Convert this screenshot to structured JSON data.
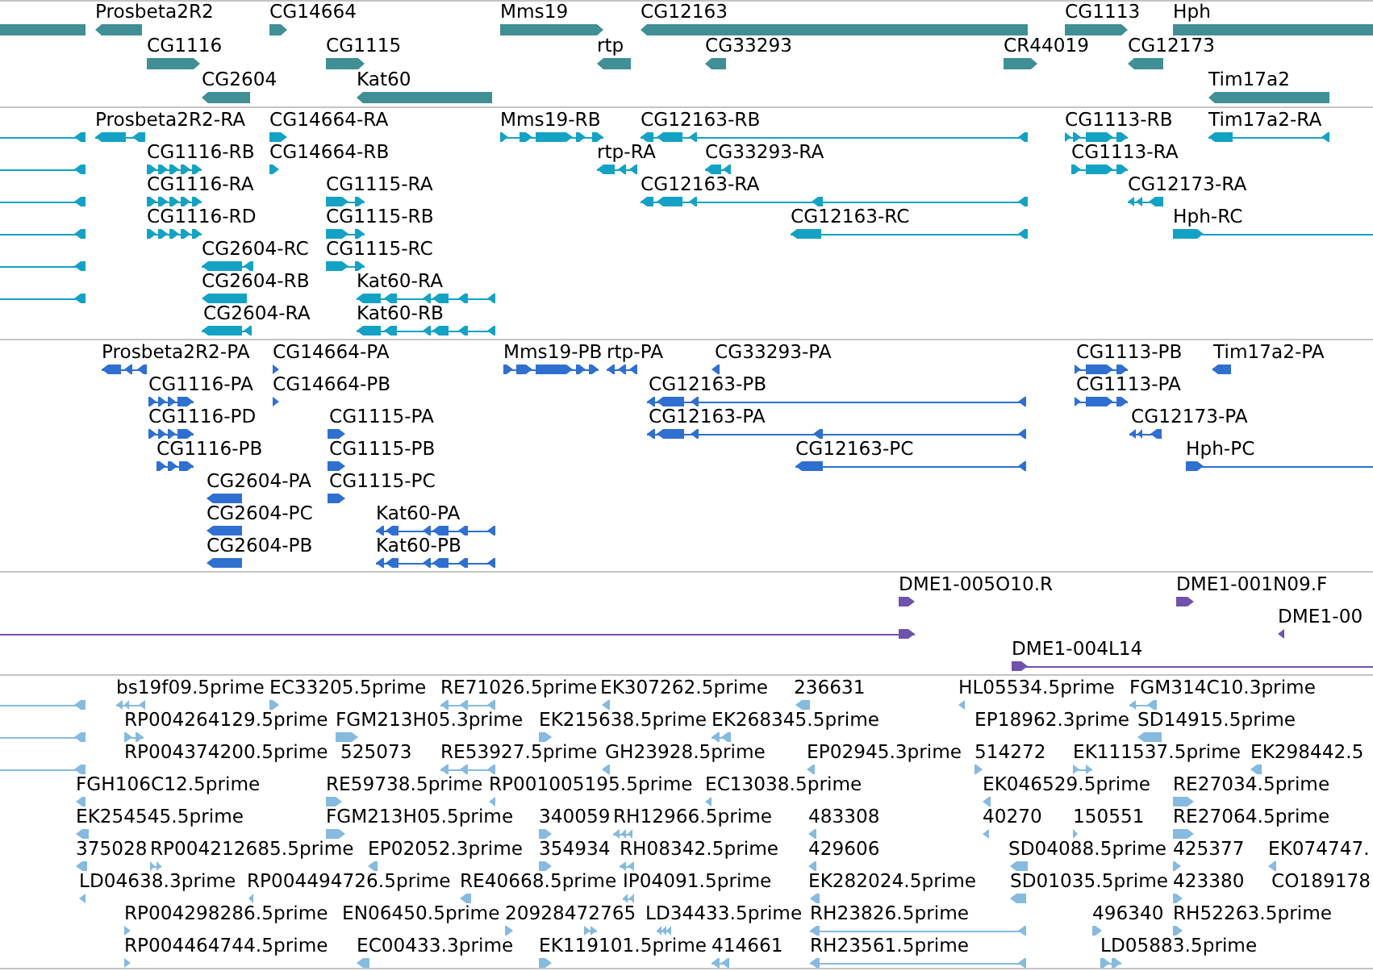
{
  "tracks": [
    {
      "kind": "gene",
      "lanes": [
        {
          "features": [
            {
              "reverse": true
            },
            {
              "label": "Prosbeta2R2",
              "reverse": true
            },
            {
              "label": "CG14664",
              "reverse": false
            },
            {
              "label": "Mms19",
              "reverse": false
            },
            {
              "label": "CG12163",
              "reverse": true
            },
            {
              "label": "CG1113",
              "reverse": false
            },
            {
              "label": "Hph",
              "reverse": false
            }
          ]
        },
        {
          "features": [
            {
              "label": "CG1116",
              "reverse": false
            },
            {
              "label": "CG1115",
              "reverse": false
            },
            {
              "label": "rtp",
              "reverse": true
            },
            {
              "label": "CG33293",
              "reverse": true
            },
            {
              "label": "CR44019",
              "reverse": false
            },
            {
              "label": "CG12173",
              "reverse": true
            }
          ]
        },
        {
          "features": [
            {
              "label": "CG2604",
              "reverse": true
            },
            {
              "label": "Kat60",
              "reverse": true
            },
            {
              "label": "Tim17a2",
              "reverse": true
            }
          ]
        }
      ]
    },
    {
      "kind": "transcript",
      "lanes": [
        {
          "features": [
            {
              "reverse": true
            },
            {
              "label": "Prosbeta2R2-RA",
              "reverse": true
            },
            {
              "label": "CG14664-RA",
              "reverse": false
            },
            {
              "label": "Mms19-RB",
              "reverse": false
            },
            {
              "label": "CG12163-RB",
              "reverse": true
            },
            {
              "label": "CG1113-RB",
              "reverse": false
            },
            {
              "label": "Tim17a2-RA",
              "reverse": true
            }
          ]
        },
        {
          "features": [
            {
              "reverse": true
            },
            {
              "label": "CG1116-RB",
              "reverse": false
            },
            {
              "label": "CG14664-RB",
              "reverse": false
            },
            {
              "label": "rtp-RA",
              "reverse": true
            },
            {
              "label": "CG33293-RA",
              "reverse": true
            },
            {
              "label": "CG1113-RA",
              "reverse": false
            }
          ]
        },
        {
          "features": [
            {
              "reverse": true
            },
            {
              "label": "CG1116-RA",
              "reverse": false
            },
            {
              "label": "CG1115-RA",
              "reverse": false
            },
            {
              "label": "CG12163-RA",
              "reverse": true
            },
            {
              "label": "CG12173-RA",
              "reverse": true
            }
          ]
        },
        {
          "features": [
            {
              "reverse": true
            },
            {
              "label": "CG1116-RD",
              "reverse": false
            },
            {
              "label": "CG1115-RB",
              "reverse": false
            },
            {
              "label": "CG12163-RC",
              "reverse": true
            },
            {
              "label": "Hph-RC",
              "reverse": false
            }
          ]
        },
        {
          "features": [
            {
              "reverse": true
            },
            {
              "label": "CG2604-RC",
              "reverse": true
            },
            {
              "label": "CG1115-RC",
              "reverse": false
            }
          ]
        },
        {
          "features": [
            {
              "reverse": true
            },
            {
              "label": "CG2604-RB",
              "reverse": true
            },
            {
              "label": "Kat60-RA",
              "reverse": true
            }
          ]
        },
        {
          "features": [
            {
              "label": "CG2604-RA",
              "reverse": true
            },
            {
              "label": "Kat60-RB",
              "reverse": true
            }
          ]
        }
      ]
    },
    {
      "kind": "protein",
      "lanes": [
        {
          "features": [
            {
              "label": "Prosbeta2R2-PA",
              "reverse": true
            },
            {
              "label": "CG14664-PA",
              "reverse": false
            },
            {
              "label": "Mms19-PB",
              "reverse": false
            },
            {
              "label": "rtp-PA",
              "reverse": true
            },
            {
              "label": "CG33293-PA",
              "reverse": true
            },
            {
              "label": "CG1113-PB",
              "reverse": false
            },
            {
              "label": "Tim17a2-PA",
              "reverse": true
            }
          ]
        },
        {
          "features": [
            {
              "label": "CG1116-PA",
              "reverse": false
            },
            {
              "label": "CG14664-PB",
              "reverse": false
            },
            {
              "label": "CG12163-PB",
              "reverse": true
            },
            {
              "label": "CG1113-PA",
              "reverse": false
            }
          ]
        },
        {
          "features": [
            {
              "label": "CG1116-PD",
              "reverse": false
            },
            {
              "label": "CG1115-PA",
              "reverse": false
            },
            {
              "label": "CG12163-PA",
              "reverse": true
            },
            {
              "label": "CG12173-PA",
              "reverse": true
            }
          ]
        },
        {
          "features": [
            {
              "label": "CG1116-PB",
              "reverse": false
            },
            {
              "label": "CG1115-PB",
              "reverse": false
            },
            {
              "label": "CG12163-PC",
              "reverse": true
            },
            {
              "label": "Hph-PC",
              "reverse": false
            }
          ]
        },
        {
          "features": [
            {
              "label": "CG2604-PA",
              "reverse": true
            },
            {
              "label": "CG1115-PC",
              "reverse": false
            }
          ]
        },
        {
          "features": [
            {
              "label": "CG2604-PC",
              "reverse": true
            },
            {
              "label": "Kat60-PA",
              "reverse": true
            }
          ]
        },
        {
          "features": [
            {
              "label": "CG2604-PB",
              "reverse": true
            },
            {
              "label": "Kat60-PB",
              "reverse": true
            }
          ]
        }
      ]
    },
    {
      "kind": "probe",
      "lanes": [
        {
          "features": [
            {
              "label": "DME1-005O10.R",
              "reverse": false
            },
            {
              "label": "DME1-001N09.F",
              "reverse": false
            }
          ]
        },
        {
          "features": [
            {
              "reverse": false
            },
            {
              "label": "DME1-00",
              "reverse": true
            }
          ]
        },
        {
          "features": [
            {
              "label": "DME1-004L14",
              "reverse": false
            }
          ]
        }
      ]
    },
    {
      "kind": "est",
      "lanes": [
        {
          "features": [
            {
              "reverse": true
            },
            {
              "label": "bs19f09.5prime",
              "reverse": true
            },
            {
              "label": "EC33205.5prime",
              "reverse": false
            },
            {
              "label": "RE71026.5prime",
              "reverse": true
            },
            {
              "label": "EK307262.5prime",
              "reverse": true
            },
            {
              "label": "236631",
              "reverse": true
            },
            {
              "label": "HL05534.5prime",
              "reverse": true
            },
            {
              "label": "FGM314C10.3prime",
              "reverse": true
            }
          ]
        },
        {
          "features": [
            {
              "reverse": true
            },
            {
              "label": "RP004264129.5prime",
              "reverse": false
            },
            {
              "label": "FGM213H05.3prime",
              "reverse": false
            },
            {
              "label": "EK215638.5prime",
              "reverse": false
            },
            {
              "label": "EK268345.5prime",
              "reverse": true
            },
            {
              "label": "EP18962.3prime"
            },
            {
              "label": "SD14915.5prime",
              "reverse": true
            }
          ]
        },
        {
          "features": [
            {
              "reverse": true
            },
            {
              "label": "RP004374200.5prime"
            },
            {
              "label": "525073"
            },
            {
              "label": "RE53927.5prime",
              "reverse": true
            },
            {
              "label": "GH23928.5prime",
              "reverse": true
            },
            {
              "label": "EP02945.3prime",
              "reverse": true
            },
            {
              "label": "514272",
              "reverse": false
            },
            {
              "label": "EK111537.5prime",
              "reverse": false
            },
            {
              "label": "EK298442.5",
              "reverse": true
            }
          ]
        },
        {
          "features": [
            {
              "label": "FGH106C12.5prime",
              "reverse": true
            },
            {
              "label": "RE59738.5prime",
              "reverse": false
            },
            {
              "label": "RP001005195.5prime",
              "reverse": true
            },
            {
              "label": "EC13038.5prime",
              "reverse": true
            },
            {
              "label": "EK046529.5prime",
              "reverse": true
            },
            {
              "label": "RE27034.5prime",
              "reverse": false
            }
          ]
        },
        {
          "features": [
            {
              "label": "EK254545.5prime",
              "reverse": true
            },
            {
              "label": "FGM213H05.5prime",
              "reverse": false
            },
            {
              "label": "340059",
              "reverse": false
            },
            {
              "label": "RH12966.5prime",
              "reverse": true
            },
            {
              "label": "483308",
              "reverse": true
            },
            {
              "label": "40270",
              "reverse": true
            },
            {
              "label": "150551",
              "reverse": false
            },
            {
              "label": "RE27064.5prime",
              "reverse": false
            }
          ]
        },
        {
          "features": [
            {
              "label": "375028",
              "reverse": true
            },
            {
              "label": "RP004212685.5prime",
              "reverse": false
            },
            {
              "label": "EP02052.3prime",
              "reverse": true
            },
            {
              "label": "354934",
              "reverse": false
            },
            {
              "label": "RH08342.5prime",
              "reverse": true
            },
            {
              "label": "429606",
              "reverse": true
            },
            {
              "label": "SD04088.5prime",
              "reverse": true
            },
            {
              "label": "425377",
              "reverse": false
            },
            {
              "label": "EK074747.",
              "reverse": true
            }
          ]
        },
        {
          "features": [
            {
              "label": "LD04638.3prime",
              "reverse": true
            },
            {
              "label": "RP004494726.5prime",
              "reverse": true
            },
            {
              "label": "RE40668.5prime",
              "reverse": true
            },
            {
              "label": "IP04091.5prime",
              "reverse": true
            },
            {
              "label": "EK282024.5prime",
              "reverse": true
            },
            {
              "label": "SD01035.5prime",
              "reverse": true
            },
            {
              "label": "423380",
              "reverse": false
            },
            {
              "label": "CO189178"
            }
          ]
        },
        {
          "features": [
            {
              "label": "RP004298286.5prime",
              "reverse": false
            },
            {
              "label": "EN06450.5prime"
            },
            {
              "label": "20928472765",
              "reverse": false
            },
            {
              "reverse": false
            },
            {
              "label": "LD34433.5prime",
              "reverse": true
            },
            {
              "label": "RH23826.5prime",
              "reverse": true
            },
            {
              "label": "496340",
              "reverse": false
            },
            {
              "label": "RH52263.5prime",
              "reverse": false
            }
          ]
        },
        {
          "features": [
            {
              "label": "RP004464744.5prime",
              "reverse": false
            },
            {
              "label": "EC00433.3prime",
              "reverse": true
            },
            {
              "label": "EK119101.5prime",
              "reverse": false
            },
            {
              "label": "414661",
              "reverse": true
            },
            {
              "label": "RH23561.5prime",
              "reverse": true
            },
            {
              "label": "LD05883.5prime",
              "reverse": false
            }
          ]
        }
      ]
    }
  ]
}
